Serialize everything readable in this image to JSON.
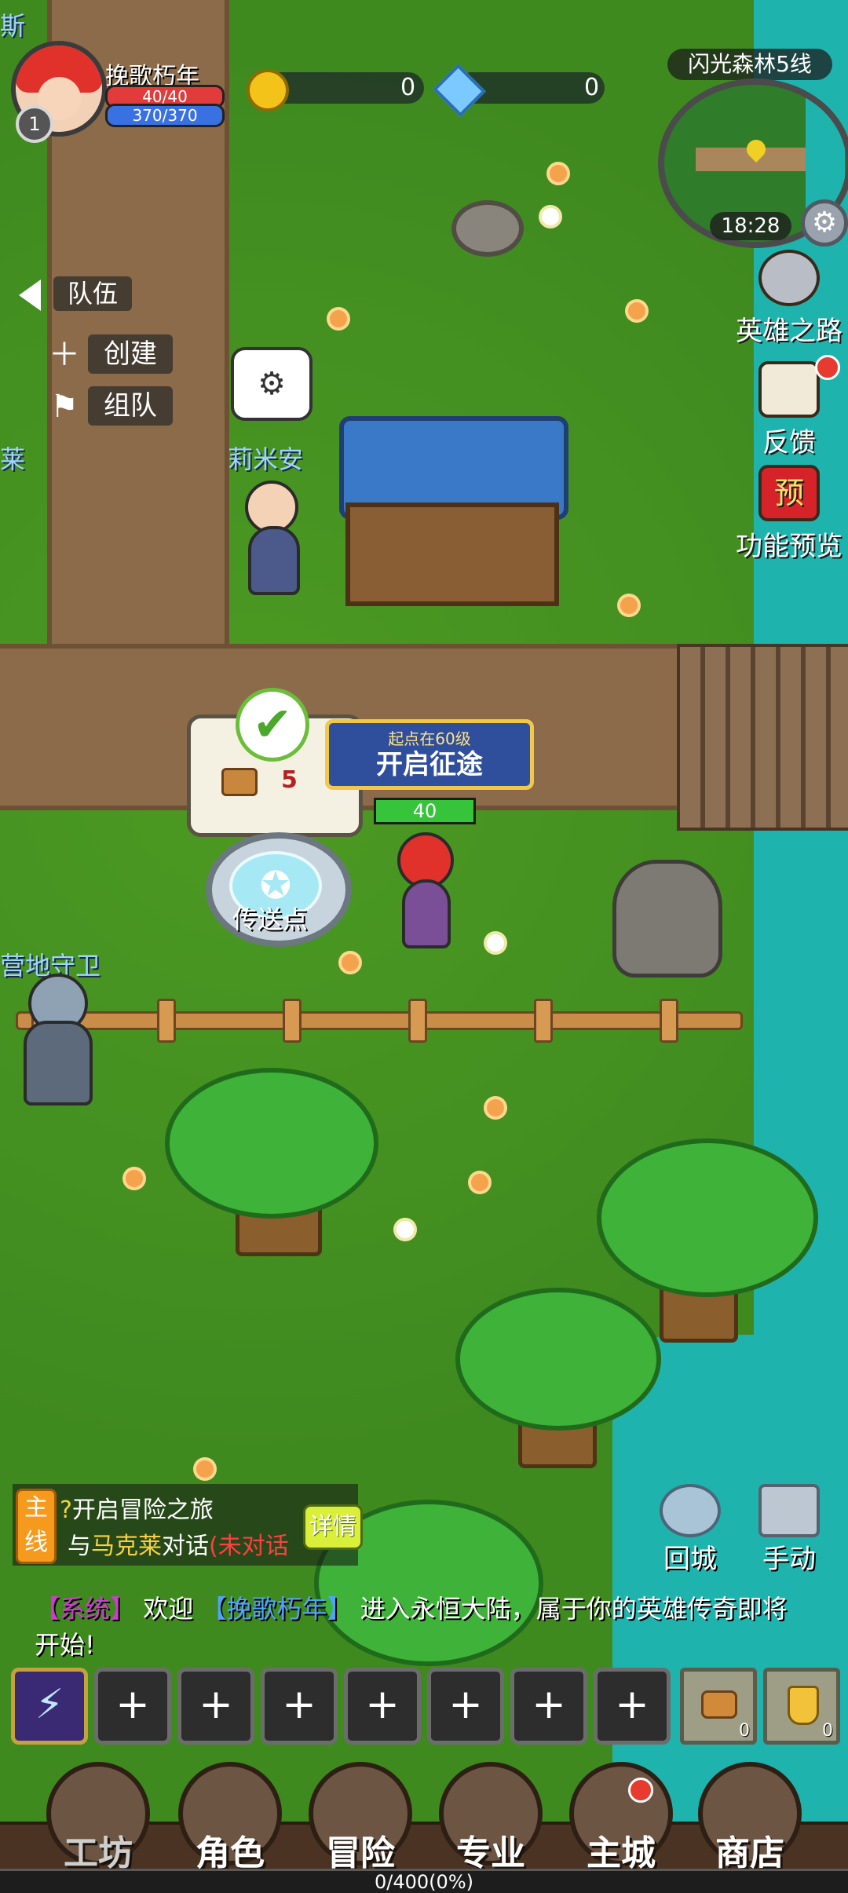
{
  "player": {
    "name": "挽歌朽年",
    "level": "1",
    "hp": "40/40",
    "mp": "370/370"
  },
  "currency": {
    "gold": "0",
    "diamond": "0"
  },
  "minimap": {
    "location": "闪光森林5线",
    "time": "18:28"
  },
  "side_menu": {
    "hero_road": "英雄之路",
    "feedback": "反馈",
    "preview": "功能预览",
    "preview_badge": "预"
  },
  "team": {
    "tab": "队伍",
    "create": "创建",
    "join": "组队"
  },
  "npcs": {
    "limian": "莉米安",
    "guard": "营地守卫",
    "edge_left_1": "斯",
    "edge_left_2": "莱"
  },
  "quest_popup": {
    "count": "5",
    "banner_sub": "起点在60级",
    "banner_main": "开启征途"
  },
  "player_level_bar": "40",
  "portal_label": "传送点",
  "quest_tracker": {
    "tag": "主线",
    "title": "开启冒险之旅",
    "desc_prefix": "与",
    "npc": "马克莱",
    "desc_mid": "对话",
    "status": "(未对话",
    "detail": "详情"
  },
  "actions": {
    "return_city": "回城",
    "manual": "手动"
  },
  "chat": {
    "sys_tag": "【系统】",
    "text1": "欢迎",
    "name": "【挽歌朽年】",
    "text2": "进入永恒大陆，属于你的英雄传奇即将开始!"
  },
  "skill_slots": [
    "+",
    "+",
    "+",
    "+",
    "+",
    "+",
    "+"
  ],
  "items": [
    {
      "icon": "bread-icon",
      "count": "0"
    },
    {
      "icon": "potion-icon",
      "count": "0"
    }
  ],
  "bottom_nav": [
    "工坊",
    "角色",
    "冒险",
    "专业",
    "主城",
    "商店"
  ],
  "exp": "0/400(0%)",
  "colors": {
    "grass": "#3f8a1f",
    "river": "#1fb3ae",
    "hp": "#e23b3b",
    "mp": "#3a71e2",
    "npc_name": "#9fd4ff",
    "quest_tag": "#f59a1c"
  }
}
